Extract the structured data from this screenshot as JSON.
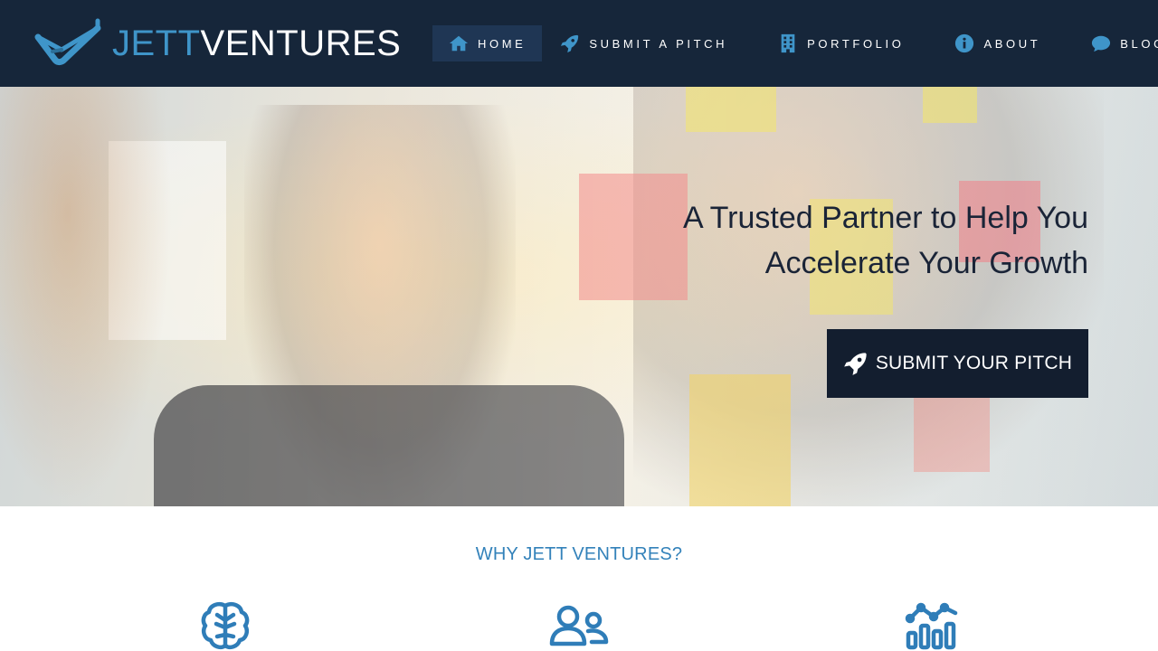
{
  "brand": {
    "logo_text_part1": "JETT",
    "logo_text_part2": "VENTURES",
    "accent": "#3f95c9",
    "dark": "#16263a"
  },
  "nav": {
    "items": [
      {
        "label": "HOME",
        "icon": "home-icon",
        "active": true
      },
      {
        "label": "SUBMIT A PITCH",
        "icon": "rocket-icon",
        "active": false
      },
      {
        "label": "PORTFOLIO",
        "icon": "building-icon",
        "active": false
      },
      {
        "label": "ABOUT",
        "icon": "info-circle-icon",
        "active": false
      },
      {
        "label": "BLOG",
        "icon": "comment-icon",
        "active": false
      }
    ]
  },
  "hero": {
    "title_line1": "A Trusted Partner to Help You",
    "title_line2": "Accelerate Your Growth",
    "cta_label": "SUBMIT YOUR PITCH",
    "cta_icon": "rocket-icon"
  },
  "why": {
    "title": "WHY JETT VENTURES?",
    "features": [
      {
        "icon": "brain-icon"
      },
      {
        "icon": "users-icon"
      },
      {
        "icon": "chart-icon"
      }
    ]
  }
}
